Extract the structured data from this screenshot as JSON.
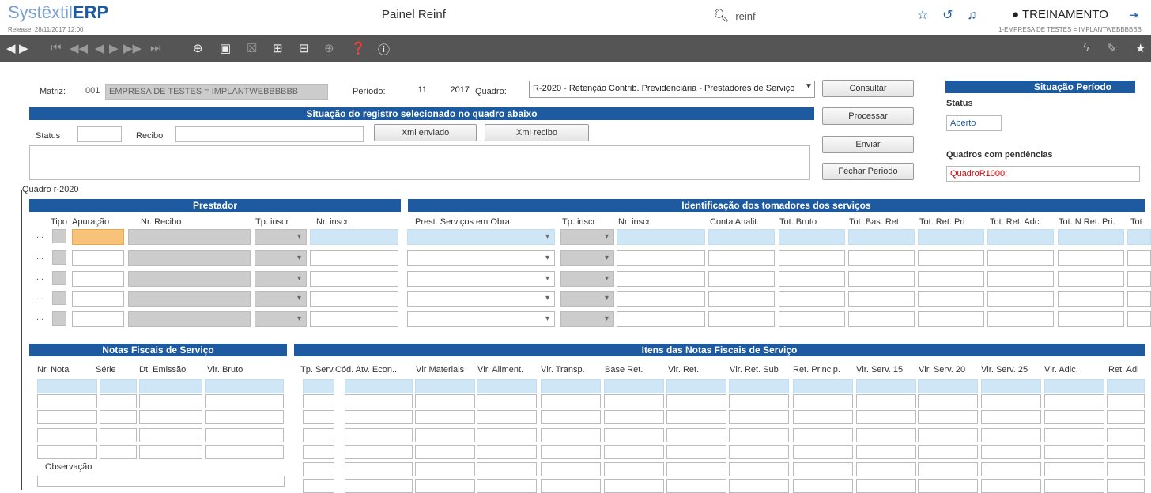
{
  "header": {
    "logo_light": "Systêxtil",
    "logo_bold": "ERP",
    "release": "Release: 28/11/2017 12:00",
    "page_title": "Painel Reinf",
    "search_value": "reinf",
    "user": "TREINAMENTO",
    "company": "1-EMPRESA DE TESTES = IMPLANTWEBBBBBB"
  },
  "form": {
    "matriz_label": "Matriz:",
    "matriz_code": "001",
    "matriz_name": "EMPRESA DE TESTES = IMPLANTWEBBBBBB",
    "periodo_label": "Período:",
    "periodo_mes": "11",
    "periodo_ano": "2017",
    "quadro_label": "Quadro:",
    "quadro_value": "R-2020 - Retenção Contrib. Previdenciária - Prestadores de Serviço"
  },
  "registro": {
    "title": "Situação do registro selecionado no quadro abaixo",
    "status_label": "Status",
    "recibo_label": "Recibo",
    "xml_enviado": "Xml enviado",
    "xml_recibo": "Xml recibo"
  },
  "actions": {
    "consultar": "Consultar",
    "processar": "Processar",
    "enviar": "Enviar",
    "fechar": "Fechar Periodo"
  },
  "situacao": {
    "title": "Situação Período",
    "status_label": "Status",
    "status_value": "Aberto",
    "pend_label": "Quadros com pendências",
    "pend_value": "QuadroR1000;"
  },
  "quadro": {
    "legend": "Quadro r-2020",
    "prestador_title": "Prestador",
    "tomadores_title": "Identificação dos tomadores dos serviços",
    "cols_prest": [
      "Tipo",
      "Apuração",
      "Nr. Recibo",
      "Tp. inscr",
      "Nr. inscr."
    ],
    "cols_tom": [
      "Prest. Serviços em Obra",
      "Tp. inscr",
      "Nr. inscr.",
      "Conta Analit.",
      "Tot. Bruto",
      "Tot. Bas. Ret.",
      "Tot. Ret. Pri",
      "Tot. Ret. Adc.",
      "Tot. N Ret. Pri.",
      "Tot"
    ]
  },
  "notas": {
    "title": "Notas Fiscais de Serviço",
    "cols": [
      "Nr. Nota",
      "Série",
      "Dt. Emissão",
      "Vlr. Bruto"
    ],
    "obs_label": "Observação"
  },
  "itens": {
    "title": "Itens das Notas Fiscais de Serviço",
    "cols": [
      "Tp. Serv.",
      "Cód. Atv. Econ..",
      "Vlr Materiais",
      "Vlr. Aliment.",
      "Vlr. Transp.",
      "Base Ret.",
      "Vlr. Ret.",
      "Vlr. Ret. Sub",
      "Ret. Princip.",
      "Vlr. Serv. 15",
      "Vlr. Serv. 20",
      "Vlr. Serv. 25",
      "Vlr. Adic.",
      "Ret. Adi"
    ]
  },
  "dots": "..."
}
